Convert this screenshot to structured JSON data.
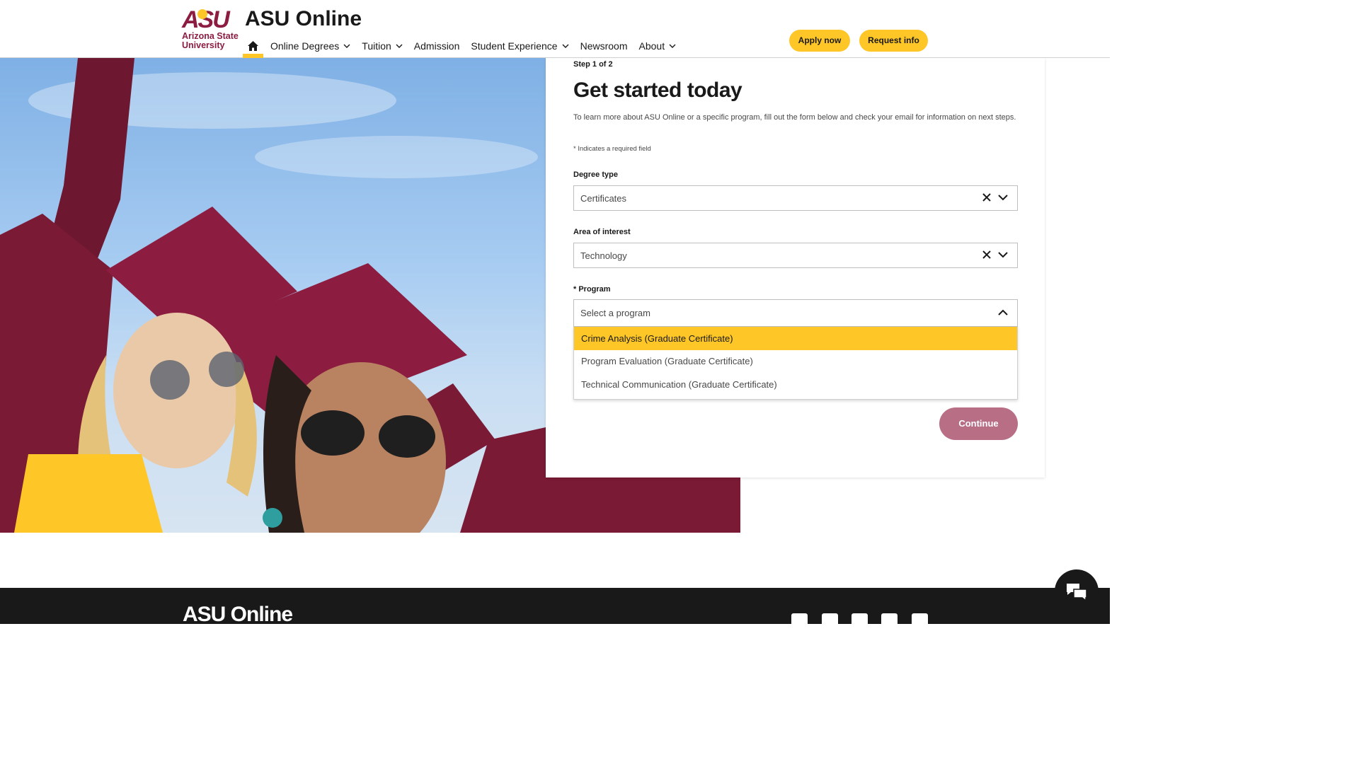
{
  "header": {
    "logo_asu": "ASU",
    "logo_name": "Arizona State University",
    "site_title": "ASU Online",
    "nav": [
      {
        "label": "Online Degrees"
      },
      {
        "label": "Tuition"
      },
      {
        "label": "Admission"
      },
      {
        "label": "Student Experience"
      },
      {
        "label": "Newsroom"
      },
      {
        "label": "About"
      }
    ],
    "apply_label": "Apply now",
    "request_label": "Request info"
  },
  "form": {
    "step": "Step 1 of 2",
    "title": "Get started today",
    "intro": "To learn more about ASU Online or a specific program, fill out the form below and check your email for information on next steps.",
    "required_note": "* Indicates a required field",
    "degree_type": {
      "label": "Degree type",
      "value": "Certificates"
    },
    "area_of_interest": {
      "label": "Area of interest",
      "value": "Technology"
    },
    "program": {
      "label": "* Program",
      "placeholder": "Select a program",
      "options": [
        "Crime Analysis (Graduate Certificate)",
        "Program Evaluation (Graduate Certificate)",
        "Technical Communication (Graduate Certificate)"
      ]
    },
    "continue_label": "Continue"
  },
  "footer": {
    "logo": "ASU Online",
    "social_icons": [
      "facebook-icon",
      "twitter-icon",
      "linkedin-icon",
      "instagram-icon",
      "youtube-icon"
    ]
  },
  "colors": {
    "maroon": "#8c1d40",
    "gold": "#ffc627",
    "continue_button": "#b86f86",
    "footer_bg": "#191919"
  }
}
